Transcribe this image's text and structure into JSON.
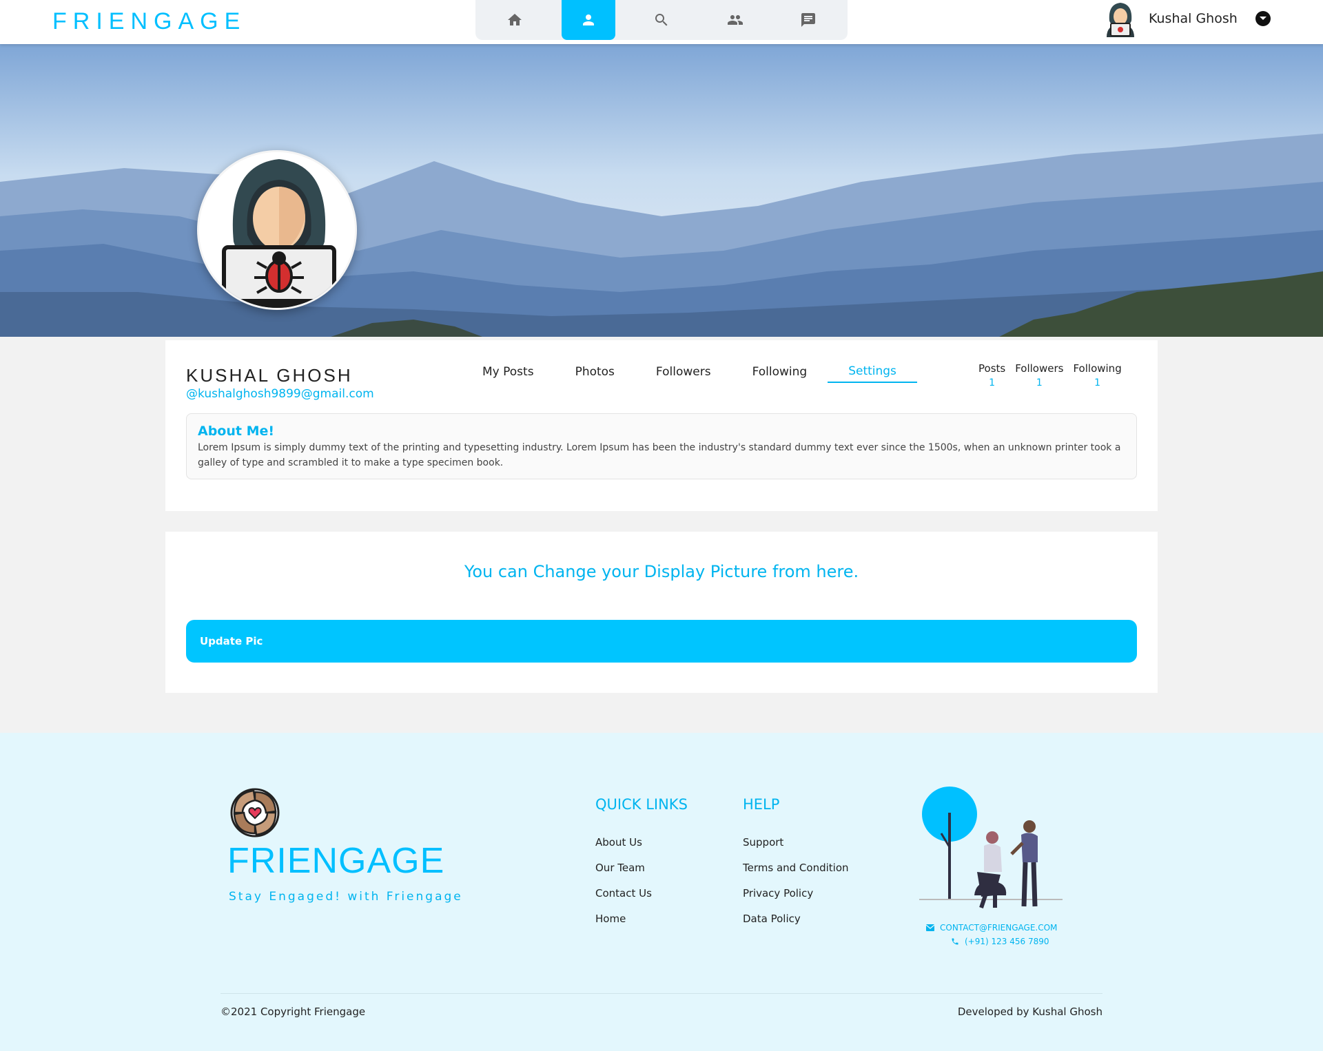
{
  "brand": "FRIENGAGE",
  "nav": {
    "tabs": [
      {
        "icon": "home-icon"
      },
      {
        "icon": "person-icon",
        "active": true
      },
      {
        "icon": "search-icon"
      },
      {
        "icon": "group-icon"
      },
      {
        "icon": "chat-icon"
      }
    ]
  },
  "user": {
    "name": "Kushal Ghosh"
  },
  "profile": {
    "name": "KUSHAL GHOSH",
    "email": "@kushalghosh9899@gmail.com",
    "tabs": [
      "My Posts",
      "Photos",
      "Followers",
      "Following",
      "Settings"
    ],
    "active_tab": "Settings",
    "stats": [
      {
        "label": "Posts",
        "value": "1"
      },
      {
        "label": "Followers",
        "value": "1"
      },
      {
        "label": "Following",
        "value": "1"
      }
    ],
    "about_title": "About Me!",
    "about_text": "Lorem Ipsum is simply dummy text of the printing and typesetting industry. Lorem Ipsum has been the industry's standard dummy text ever since the 1500s, when an unknown printer took a galley of type and scrambled it to make a type specimen book."
  },
  "settings": {
    "message": "You can Change your Display Picture from here.",
    "button": "Update Pic"
  },
  "footer": {
    "brand": "FRIENGAGE",
    "tagline": "Stay Engaged! with Friengage",
    "quick_links_title": "QUICK LINKS",
    "quick_links": [
      "About Us",
      "Our Team",
      "Contact Us",
      "Home"
    ],
    "help_title": "HELP",
    "help_links": [
      "Support",
      "Terms and Condition",
      "Privacy Policy",
      "Data Policy"
    ],
    "email": "CONTACT@FRIENGAGE.COM",
    "phone": "(+91) 123 456 7890",
    "copyright": "©2021 Copyright Friengage",
    "developed_by": "Developed by Kushal Ghosh"
  },
  "colors": {
    "accent": "#00bfff",
    "footer_bg": "#e3f7fd",
    "page_bg": "#f2f2f2"
  }
}
